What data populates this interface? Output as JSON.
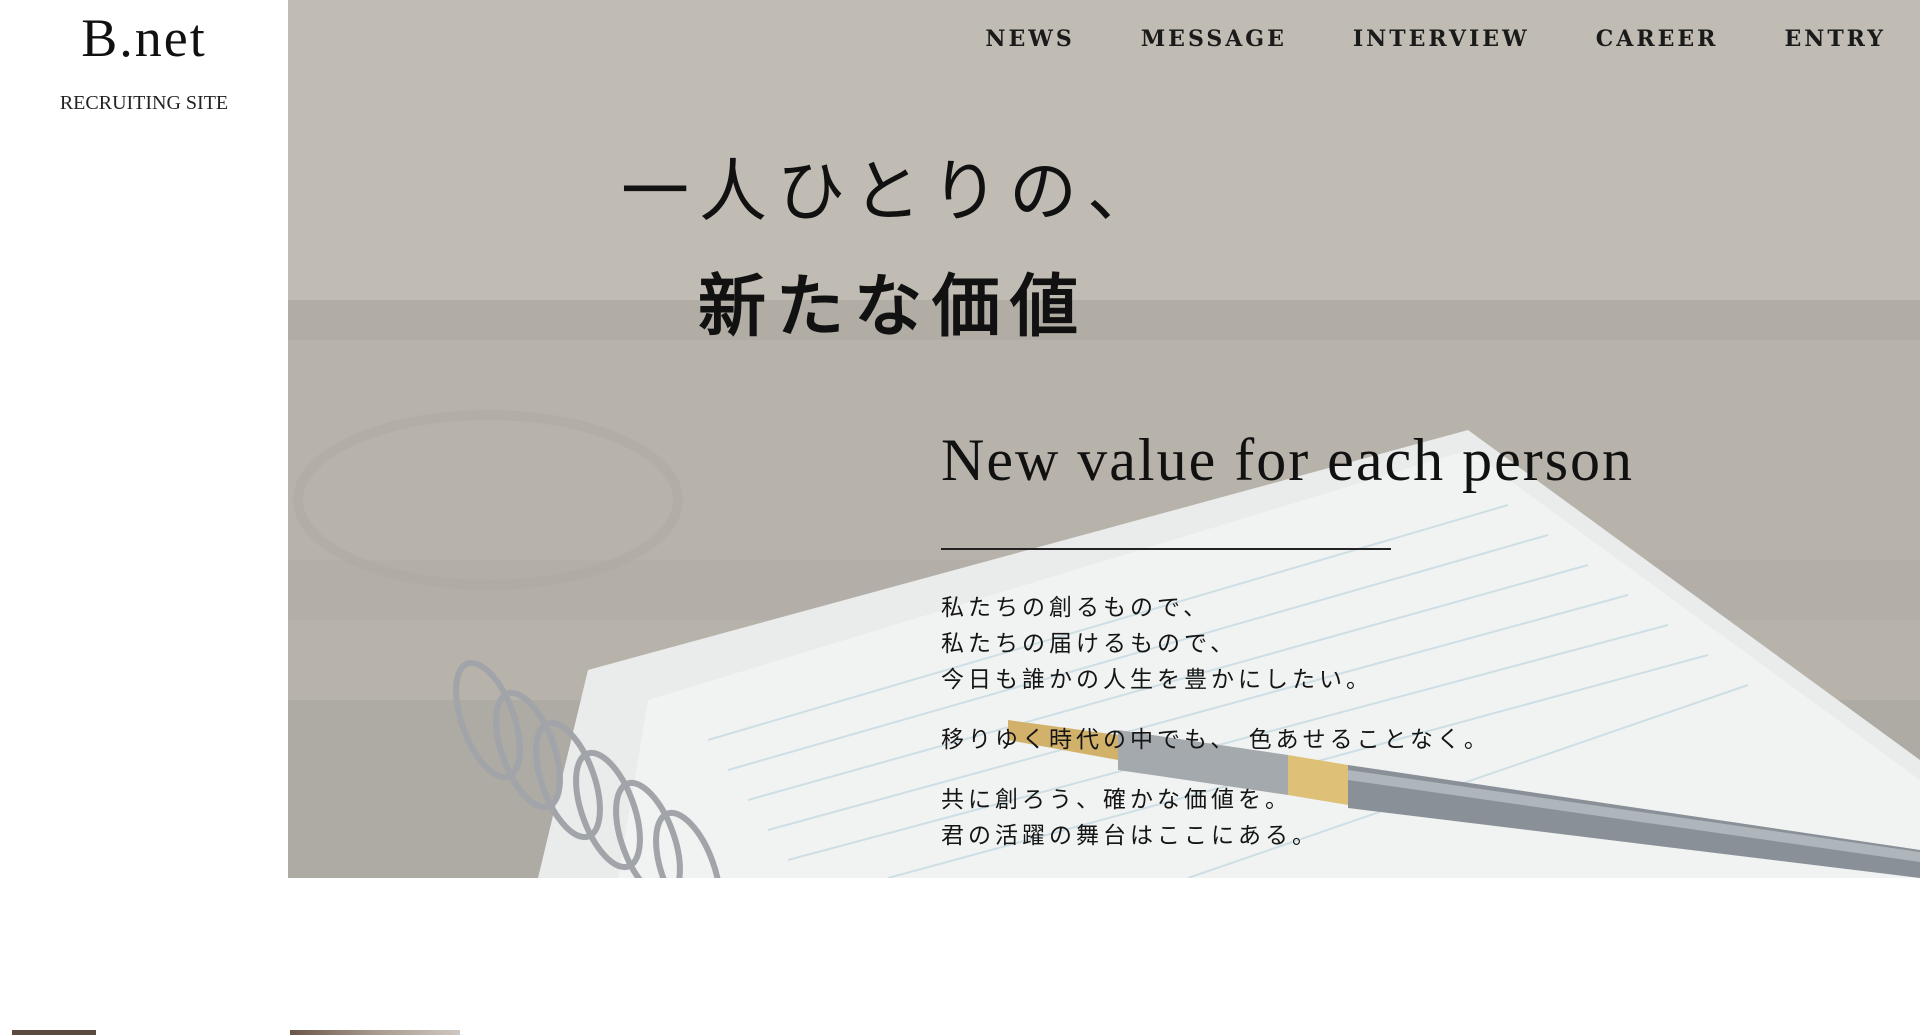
{
  "brand": {
    "logo": "B.net",
    "subtitle": "RECRUITING SITE"
  },
  "nav": {
    "items": [
      {
        "label": "NEWS"
      },
      {
        "label": "MESSAGE"
      },
      {
        "label": "INTERVIEW"
      },
      {
        "label": "CAREER"
      },
      {
        "label": "ENTRY"
      }
    ]
  },
  "hero": {
    "headline_line1": "一人ひとりの、",
    "headline_line2": "新たな価値",
    "english_title": "New value for each person",
    "paragraph1": [
      "私たちの創るもので、",
      "私たちの届けるもので、",
      "今日も誰かの人生を豊かにしたい。"
    ],
    "paragraph2": [
      "移りゆく時代の中でも、 色あせることなく。"
    ],
    "paragraph3": [
      "共に創ろう、確かな価値を。",
      "君の活躍の舞台はここにある。"
    ],
    "background_image": "notebook-and-fountain-pen-photo"
  },
  "colors": {
    "text": "#111111",
    "background": "#ffffff",
    "hero_tint": "#b3ada4"
  }
}
